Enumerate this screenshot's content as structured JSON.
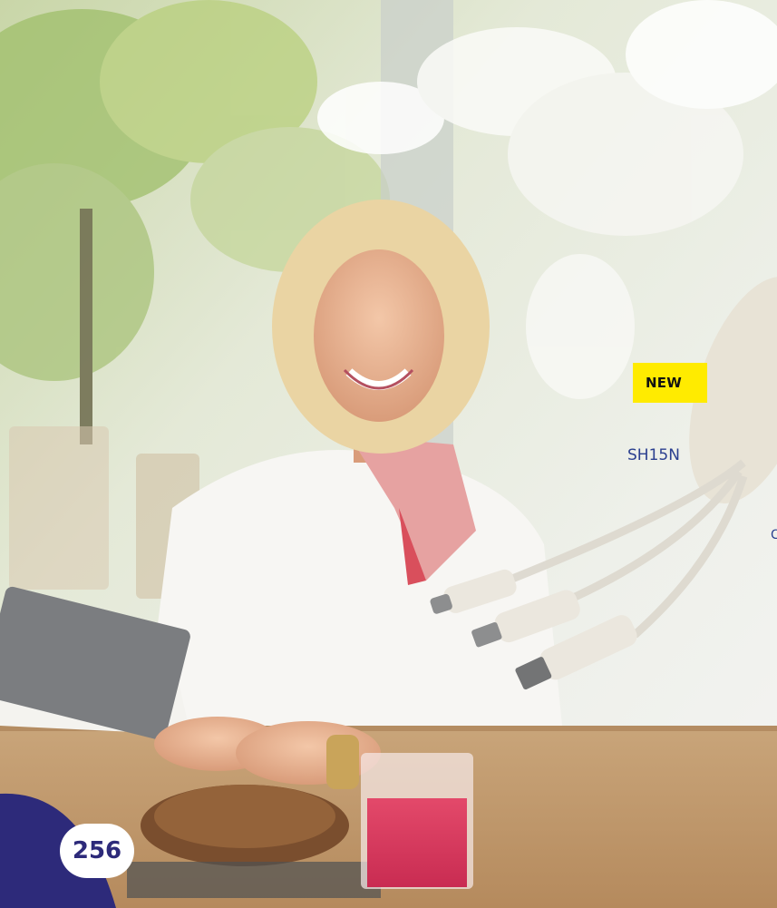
{
  "badge": {
    "label": "NEW"
  },
  "product": {
    "code": "SH15N",
    "cut_text": "C"
  },
  "page": {
    "number": "256"
  },
  "colors": {
    "accent_yellow": "#ffeb00",
    "navy": "#2d2a7a",
    "sku_blue": "#2a3f8f"
  }
}
